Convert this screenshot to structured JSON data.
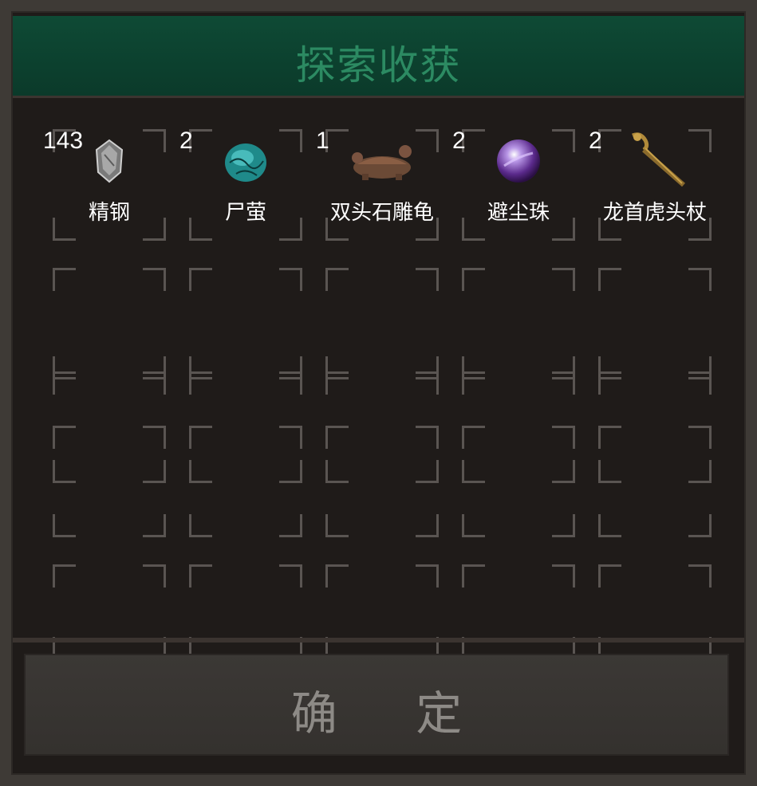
{
  "dialog": {
    "title": "探索收获",
    "confirm_label": "确 定"
  },
  "items": [
    {
      "count": "143",
      "name": "精钢",
      "icon": "steel-ingot-icon"
    },
    {
      "count": "2",
      "name": "尸萤",
      "icon": "cyan-egg-icon"
    },
    {
      "count": "1",
      "name": "双头石雕龟",
      "icon": "stone-turtle-icon"
    },
    {
      "count": "2",
      "name": "避尘珠",
      "icon": "purple-orb-icon"
    },
    {
      "count": "2",
      "name": "龙首虎头杖",
      "icon": "dragon-staff-icon"
    }
  ],
  "grid": {
    "columns": 5,
    "rows": 5
  },
  "colors": {
    "title_bar": "#0e4a35",
    "title_text": "#2c8a62",
    "panel_bg": "#1f1b19",
    "slot_corner": "#5a5552",
    "confirm_bg": "#3b3835",
    "confirm_text": "#8d8a86"
  }
}
